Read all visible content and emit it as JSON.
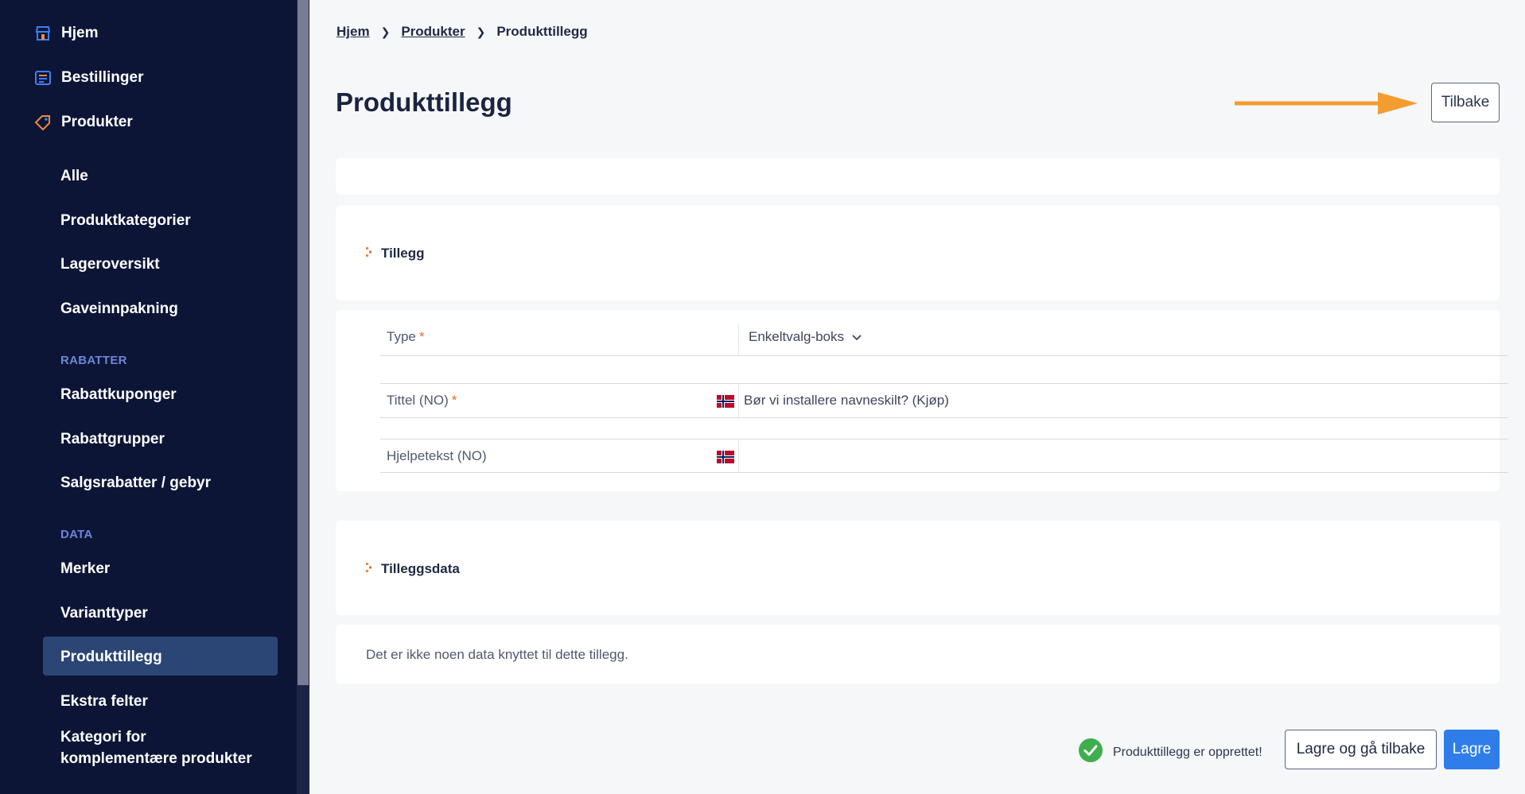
{
  "sidebar": {
    "top_items": [
      {
        "label": "Hjem",
        "icon": "store-icon"
      },
      {
        "label": "Bestillinger",
        "icon": "orders-icon"
      },
      {
        "label": "Produkter",
        "icon": "tag-icon"
      }
    ],
    "produkter_items": [
      "Alle",
      "Produktkategorier",
      "Lageroversikt",
      "Gaveinnpakning"
    ],
    "section_rabatter": "RABATTER",
    "rabatter_items": [
      "Rabattkuponger",
      "Rabattgrupper",
      "Salgsrabatter / gebyr"
    ],
    "section_data": "DATA",
    "data_items": [
      "Merker",
      "Varianttyper",
      "Produkttillegg",
      "Ekstra felter"
    ],
    "data_item_multiline": [
      "Kategori for",
      "komplementære produkter"
    ],
    "active_item": "Produkttillegg"
  },
  "breadcrumb": {
    "items": [
      "Hjem",
      "Produkter",
      "Produkttillegg"
    ]
  },
  "page": {
    "title": "Produkttillegg",
    "back_label": "Tilbake"
  },
  "section_tillegg": {
    "title": "Tillegg"
  },
  "form": {
    "type_label": "Type",
    "type_value": "Enkeltvalg-boks",
    "title_label": "Tittel (NO)",
    "title_value": "Bør vi installere navneskilt? (Kjøp)",
    "help_label": "Hjelpetekst (NO)",
    "help_value": "",
    "required_mark": "*"
  },
  "section_data": {
    "title": "Tilleggsdata",
    "empty_text": "Det er ikke noen data knyttet til dette tillegg."
  },
  "footer": {
    "status_text": "Produkttillegg er opprettet!",
    "save_back_label": "Lagre og gå tilbake",
    "save_label": "Lagre"
  },
  "colors": {
    "sidebar_bg": "#0d1537",
    "accent": "#2e7de9",
    "arrow": "#f39c2f",
    "success": "#3fae4f",
    "required": "#e8692b"
  }
}
